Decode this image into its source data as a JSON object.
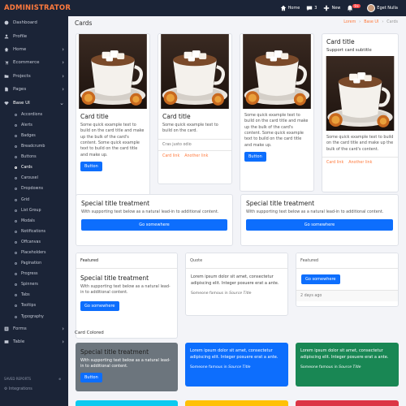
{
  "topbar": {
    "brand": "ADMINISTRATOR",
    "home": "Home",
    "messages_count": "3",
    "new": "New",
    "notif_count": "9+",
    "user": "Eget Nulla"
  },
  "sidebar": {
    "items": [
      {
        "label": "Dashboard",
        "icon": "palette-icon"
      },
      {
        "label": "Profile",
        "icon": "user-icon"
      },
      {
        "label": "Home",
        "icon": "home-icon"
      },
      {
        "label": "Ecommerce",
        "icon": "cart-icon"
      },
      {
        "label": "Projects",
        "icon": "folder-icon"
      },
      {
        "label": "Pages",
        "icon": "file-icon"
      },
      {
        "label": "Base UI",
        "icon": "gem-icon"
      }
    ],
    "sub_items": [
      "Accordions",
      "Alerts",
      "Badges",
      "Breadcrumb",
      "Buttons",
      "Cards",
      "Carousel",
      "Dropdowns",
      "Grid",
      "List Group",
      "Modals",
      "Notifications",
      "Offcanvas",
      "Placeholders",
      "Pagination",
      "Progress",
      "Spinners",
      "Tabs",
      "Tooltips",
      "Typography"
    ],
    "bottom_items": [
      {
        "label": "Forms",
        "icon": "form-icon"
      },
      {
        "label": "Table",
        "icon": "table-icon"
      }
    ],
    "footer_title": "SAVED REPORTS",
    "footer_item": "Integrations"
  },
  "page": {
    "title": "Cards",
    "breadcrumb": [
      "Lorem",
      "Base UI",
      "Cards"
    ]
  },
  "cards": {
    "c1": {
      "title": "Card title",
      "text": "Some quick example text to build on the card title and make up the bulk of the card's content. Some quick example text to build on the card title and make up.",
      "button": "Button"
    },
    "c2": {
      "title": "Card title",
      "text": "Some quick example text to build on the card.",
      "list_item": "Cras justo odio",
      "link1": "Card link",
      "link2": "Another link"
    },
    "c3": {
      "text": "Some quick example text to build on the card title and make up the bulk of the card's content. Some quick example text to build on the card title and make up.",
      "button": "Button"
    },
    "c4": {
      "title": "Card title",
      "subtitle": "Support card subtitle",
      "text": "Some quick example text to build on the card title and make up the bulk of the card's content.",
      "link1": "Card link",
      "link2": "Another link"
    }
  },
  "special": {
    "title": "Special title treatment",
    "text": "With supporting text below as a natural lead-in to additional content.",
    "button": "Go somewhere"
  },
  "featured": {
    "header": "Featured",
    "title": "Special title treatment",
    "text": "With supporting text below as a natural lead-in to additional content.",
    "button": "Go somewhere"
  },
  "quote_card": {
    "header": "Quote",
    "text": "Lorem ipsum dolor sit amet, consectetur adipiscing elit. Integer posuere erat a ante.",
    "source": "Someone famous in ",
    "source_title": "Source Title"
  },
  "featured2": {
    "header": "Featured",
    "button": "Go somewhere",
    "footer": "2 days ago"
  },
  "colored_section": "Card Colored",
  "colored": [
    {
      "title": "Special title treatment",
      "text": "With supporting text below as a natural lead-in to additional content.",
      "button": "Button",
      "color": "#6c757d"
    },
    {
      "text": "Lorem ipsum dolor sit amet, consectetur adipiscing elit. Integer posuere erat a ante.",
      "source": "Someone famous in ",
      "source_title": "Source Title",
      "color": "#0d6efd"
    },
    {
      "text": "Lorem ipsum dolor sit amet, consectetur adipiscing elit. Integer posuere erat a ante.",
      "source": "Someone famous in ",
      "source_title": "Source Title",
      "color": "#198754"
    }
  ],
  "bottom_colors": [
    "#0dcaf0",
    "#ffc107",
    "#dc3545"
  ],
  "colors": {
    "accent": "#ff7a3d",
    "primary": "#0d6efd",
    "sidebar": "#1b2437"
  }
}
